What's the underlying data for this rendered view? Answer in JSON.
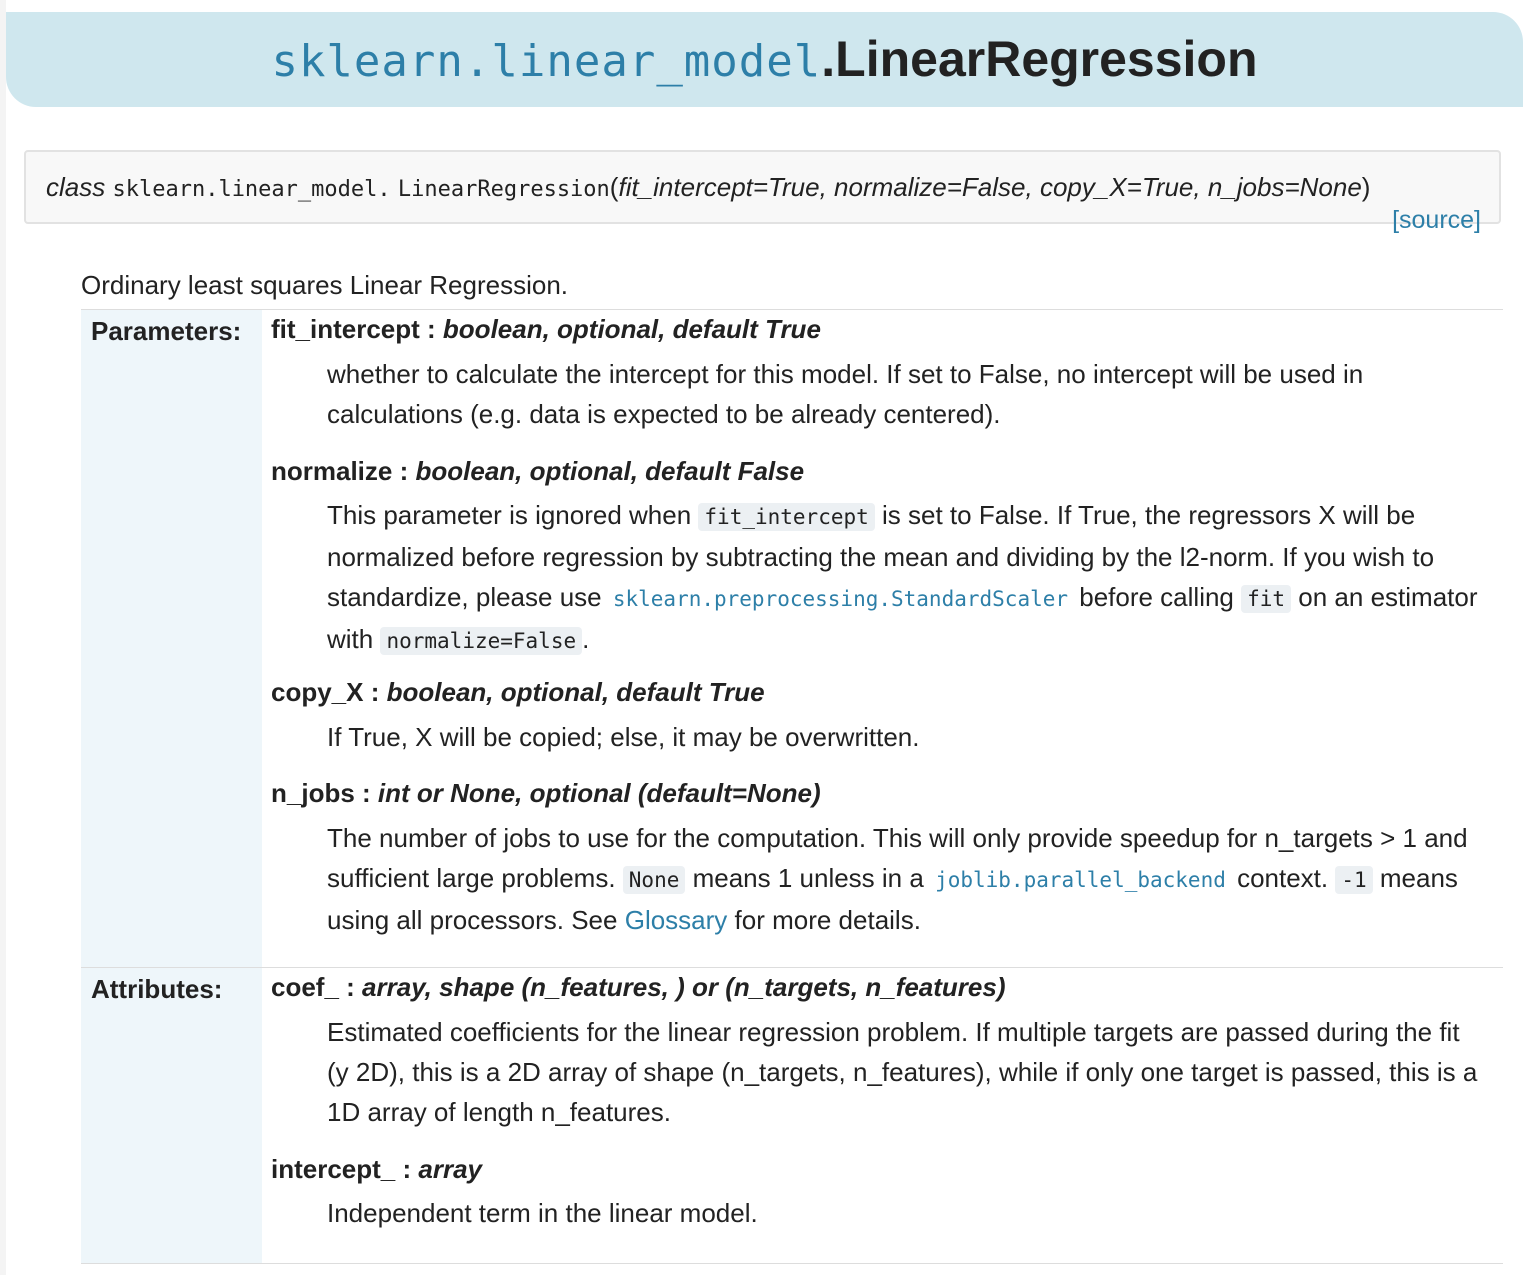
{
  "header": {
    "module": "sklearn.linear_model",
    "class_name": ".LinearRegression"
  },
  "signature": {
    "keyword": "class",
    "module": "sklearn.linear_model.",
    "name": "LinearRegression",
    "open": "(",
    "params": "fit_intercept=True, normalize=False, copy_X=True, n_jobs=None",
    "close": ")",
    "source": "[source]"
  },
  "summary": "Ordinary least squares Linear Regression.",
  "parameters": {
    "label": "Parameters:",
    "fit_intercept": {
      "name": "fit_intercept",
      "sep": " : ",
      "type": "boolean, optional, default True",
      "desc": "whether to calculate the intercept for this model. If set to False, no intercept will be used in calculations (e.g. data is expected to be already centered)."
    },
    "normalize": {
      "name": "normalize",
      "sep": " : ",
      "type": "boolean, optional, default False",
      "d1": "This parameter is ignored when ",
      "c1": "fit_intercept",
      "d2": " is set to False. If True, the regressors X will be normalized before regression by subtracting the mean and dividing by the l2-norm. If you wish to standardize, please use ",
      "l1": "sklearn.preprocessing.StandardScaler",
      "d3": " before calling ",
      "c2": "fit",
      "d4": " on an estimator with ",
      "c3": "normalize=False",
      "d5": "."
    },
    "copy_X": {
      "name": "copy_X",
      "sep": " : ",
      "type": "boolean, optional, default True",
      "desc": "If True, X will be copied; else, it may be overwritten."
    },
    "n_jobs": {
      "name": "n_jobs",
      "sep": " : ",
      "type": "int or None, optional (default=None)",
      "d1": "The number of jobs to use for the computation. This will only provide speedup for n_targets > 1 and sufficient large problems. ",
      "c1": "None",
      "d2": " means 1 unless in a ",
      "l1": "joblib.parallel_backend",
      "d3": " context. ",
      "c2": "-1",
      "d4": " means using all processors. See ",
      "l2": "Glossary",
      "d5": " for more details."
    }
  },
  "attributes": {
    "label": "Attributes:",
    "coef_": {
      "name": "coef_",
      "sep": " : ",
      "type": "array, shape (n_features, ) or (n_targets, n_features)",
      "desc": "Estimated coefficients for the linear regression problem. If multiple targets are passed during the fit (y 2D), this is a 2D array of shape (n_targets, n_features), while if only one target is passed, this is a 1D array of length n_features."
    },
    "intercept_": {
      "name": "intercept_",
      "sep": " : ",
      "type": "array",
      "desc": "Independent term in the linear model."
    }
  }
}
